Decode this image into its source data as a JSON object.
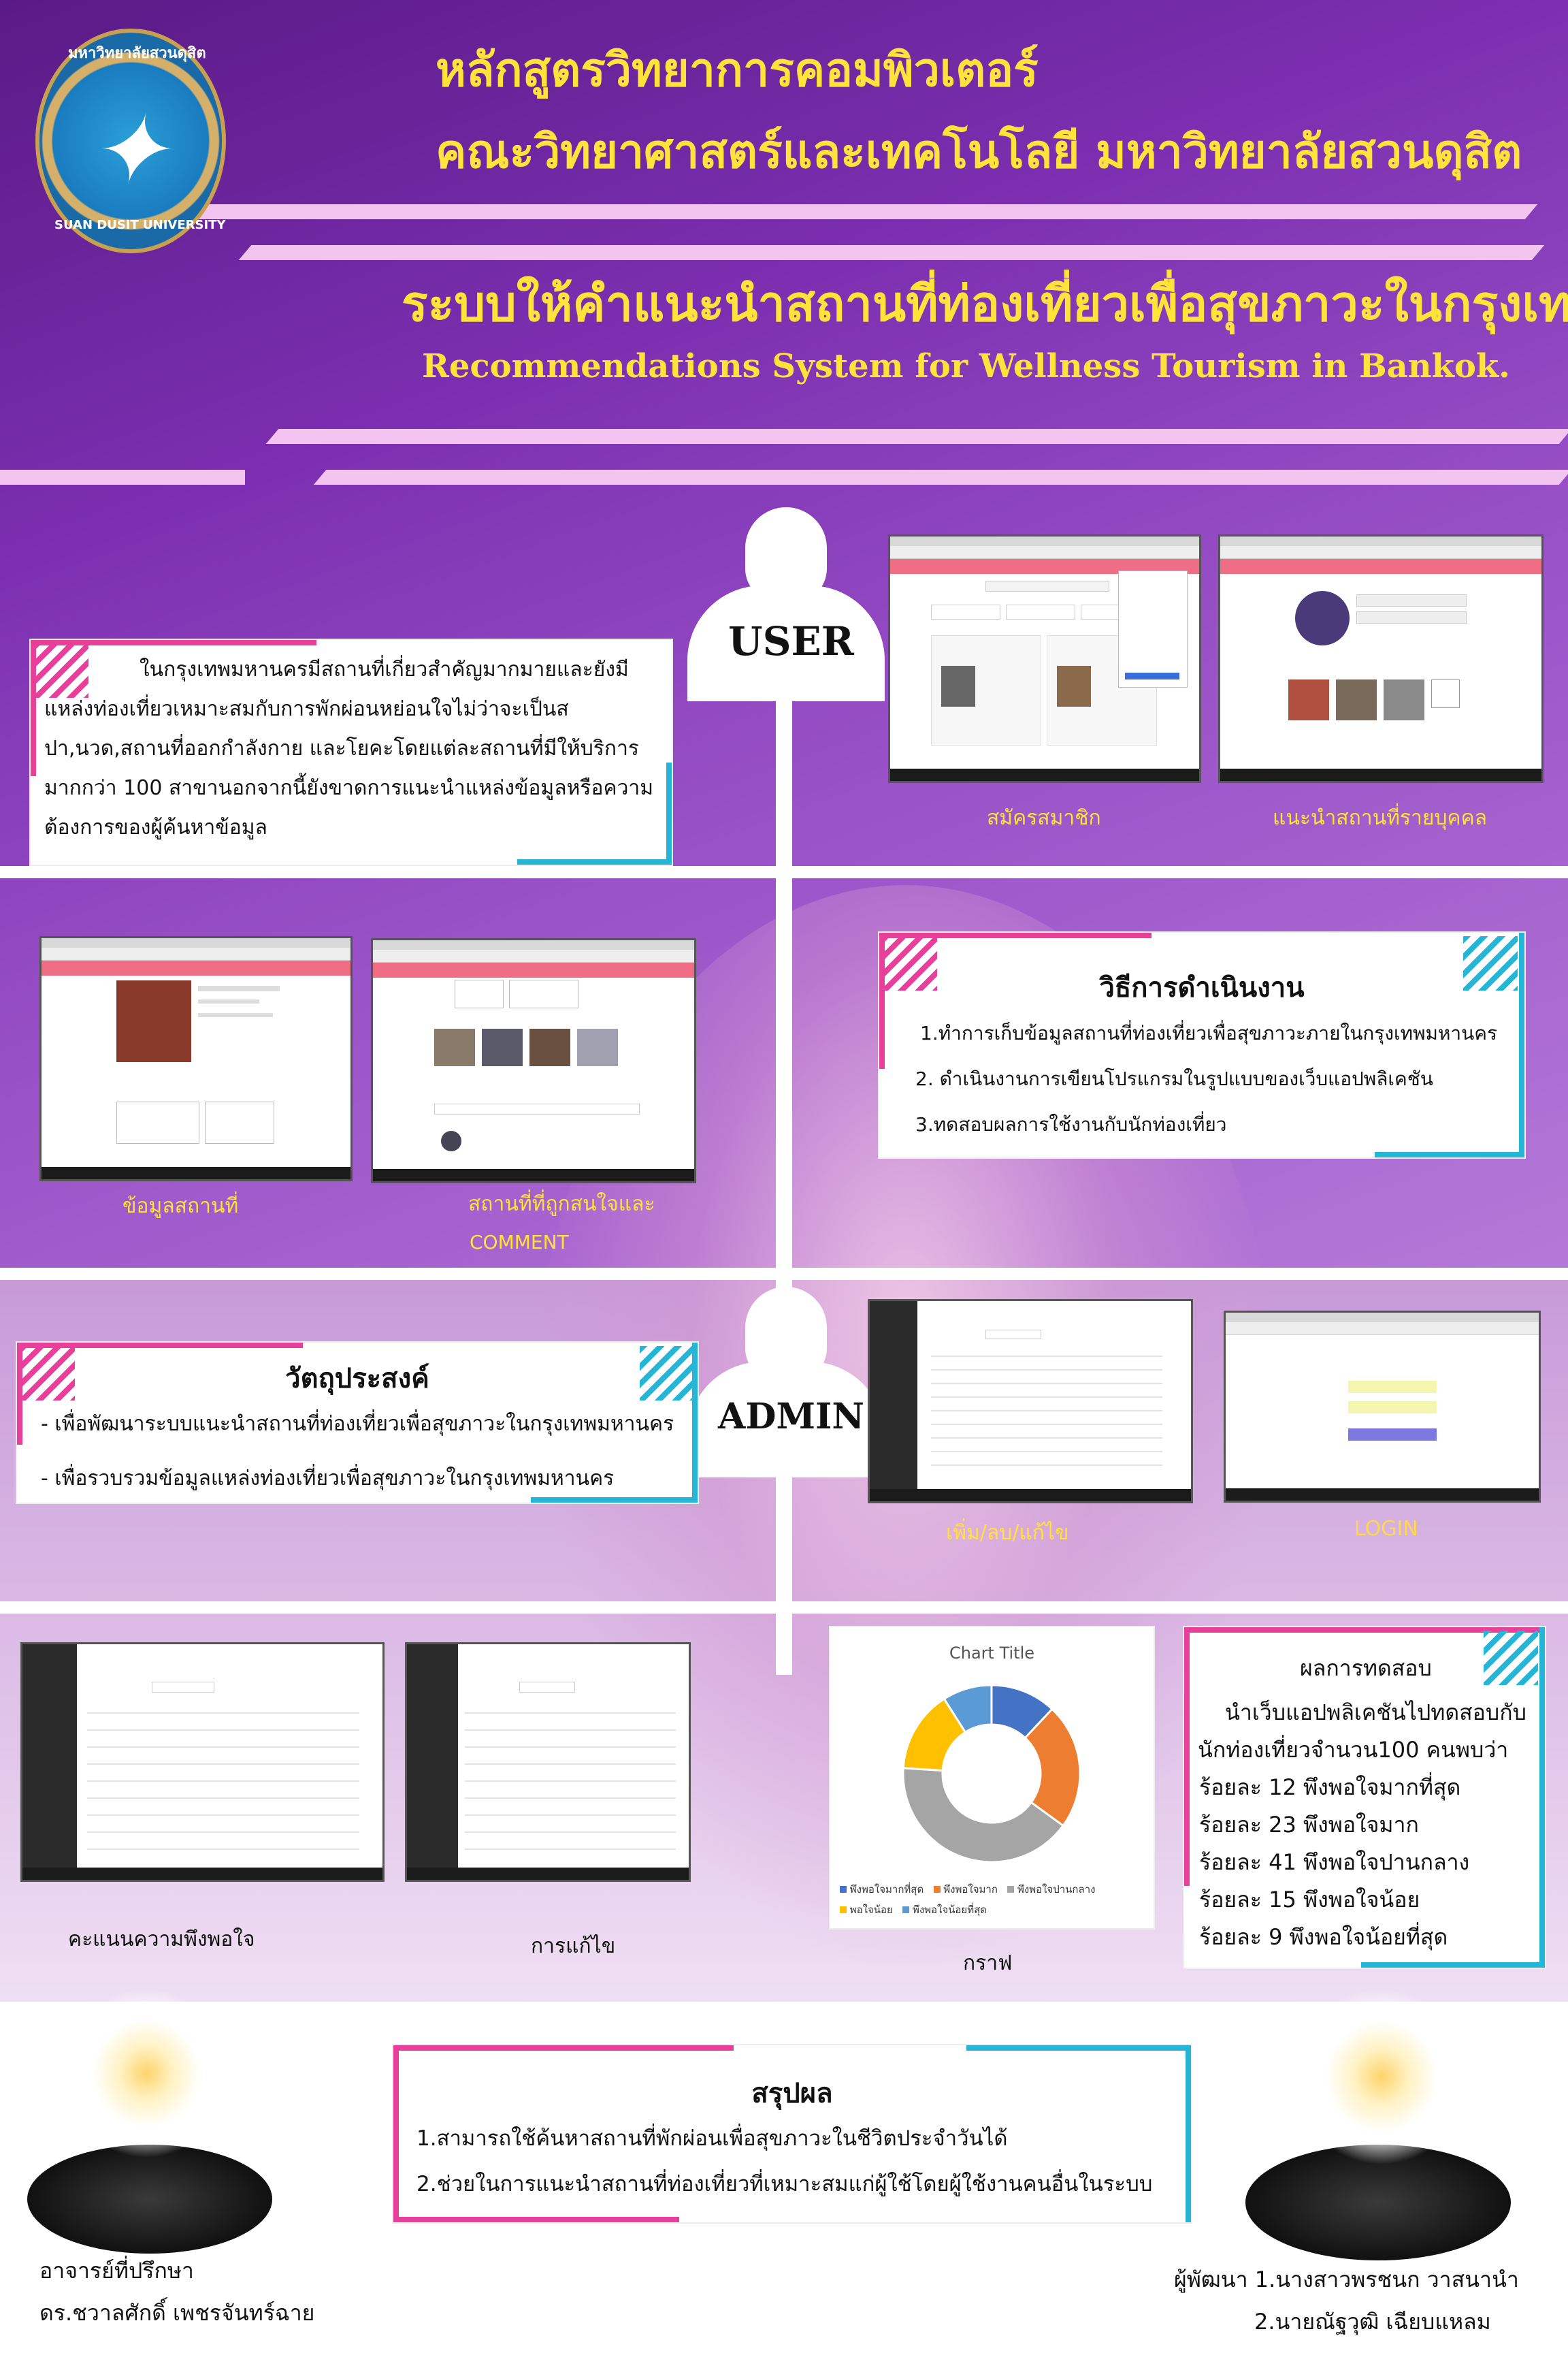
{
  "header": {
    "line1": "หลักสูตรวิทยาการคอมพิวเตอร์",
    "line2": "คณะวิทยาศาสตร์และเทคโนโลยี มหาวิทยาลัยสวนดุสิต",
    "thai_title": "ระบบให้คำแนะนำสถานที่ท่องเที่ยวเพื่อสุขภาวะในกรุงเทพ",
    "english_title": "Recommendations System for Wellness Tourism in Bankok."
  },
  "logo": {
    "arc_text_top": "มหาวิทยาลัยสวนดุสิต",
    "arc_text_bottom": "SUAN DUSIT UNIVERSITY"
  },
  "roles": {
    "user": "USER",
    "admin": "ADMIN"
  },
  "intro": {
    "paragraph": "ในกรุงเทพมหานครมีสถานที่เกี่ยวสำคัญมากมายและยังมีแหล่งท่องเที่ยวเหมาะสมกับการพักผ่อนหย่อนใจไม่ว่าจะเป็นสปา,นวด,สถานที่ออกกำลังกาย และโยคะโดยแต่ละสถานที่มีให้บริการมากกว่า 100 สาขานอกจากนี้ยังขาดการแนะนำแหล่งข้อมูลหรือความต้องการของผู้ค้นหาข้อมูล"
  },
  "captions": {
    "register": "สมัครสมาชิก",
    "personal": "แนะนำสถานที่รายบุคคล",
    "place_info": "ข้อมูลสถานที่",
    "favorites_comment_1": "สถานที่ที่ถูกสนใจและ",
    "favorites_comment_2": "COMMENT",
    "add_edit": "เพิ่ม/ลบ/แก้ไข",
    "login": "LOGIN",
    "satisfaction": "คะแนนความพึงพอใจ",
    "editing": "การแก้ไข",
    "graph": "กราฟ"
  },
  "method": {
    "heading": "วิธีการดำเนินงาน",
    "items": [
      "1.ทำการเก็บข้อมูลสถานที่ท่องเที่ยวเพื่อสุขภาวะภายในกรุงเทพมหานคร",
      "2. ดำเนินงานการเขียนโปรแกรมในรูปแบบของเว็บแอปพลิเคชัน",
      "3.ทดสอบผลการใช้งานกับนักท่องเที่ยว"
    ]
  },
  "objective": {
    "heading": "วัตถุประสงค์",
    "items": [
      "- เพื่อพัฒนาระบบแนะนำสถานที่ท่องเที่ยวเพื่อสุขภาวะในกรุงเทพมหานคร",
      "- เพื่อรวบรวมข้อมูลแหล่งท่องเที่ยวเพื่อสุขภาวะในกรุงเทพมหานคร"
    ]
  },
  "results": {
    "heading": "ผลการทดสอบ",
    "intro_1": "นำเว็บแอปพลิเคชันไปทดสอบกับ",
    "intro_2": "นักท่องเที่ยวจำนวน100 คนพบว่า",
    "lines": [
      "ร้อยละ 12 พึงพอใจมากที่สุด",
      "ร้อยละ 23  พึงพอใจมาก",
      "ร้อยละ 41 พึงพอใจปานกลาง",
      "ร้อยละ 15 พึงพอใจน้อย",
      "ร้อยละ 9 พึงพอใจน้อยที่สุด"
    ]
  },
  "conclusion": {
    "heading": "สรุปผล",
    "items": [
      "1.สามารถใช้ค้นหาสถานที่พักผ่อนเพื่อสุขภาวะในชีวิตประจำวันได้",
      "2.ช่วยในการแนะนำสถานที่ท่องเที่ยวที่เหมาะสมแก่ผู้ใช้โดยผู้ใช้งานคนอื่นในระบบ"
    ]
  },
  "advisor": {
    "label": "อาจารย์ที่ปรึกษา",
    "name": "ดร.ชวาลศักดิ์ เพชรจันทร์ฉาย"
  },
  "developers": {
    "line1": "ผู้พัฒนา 1.นางสาวพรชนก วาสนานำ",
    "line2": "2.นายณัฐวุฒิ เฉียบแหลม"
  },
  "chart_data": {
    "type": "pie",
    "title": "Chart Title",
    "categories": [
      "พึงพอใจมากที่สุด",
      "พึงพอใจมาก",
      "พึงพอใจปานกลาง",
      "พอใจน้อย",
      "พึงพอใจน้อยที่สุด"
    ],
    "values": [
      12,
      23,
      41,
      15,
      9
    ],
    "colors": [
      "#4472c4",
      "#ed7d31",
      "#a5a5a5",
      "#ffc000",
      "#5b9bd5"
    ],
    "legend": "bottom"
  }
}
